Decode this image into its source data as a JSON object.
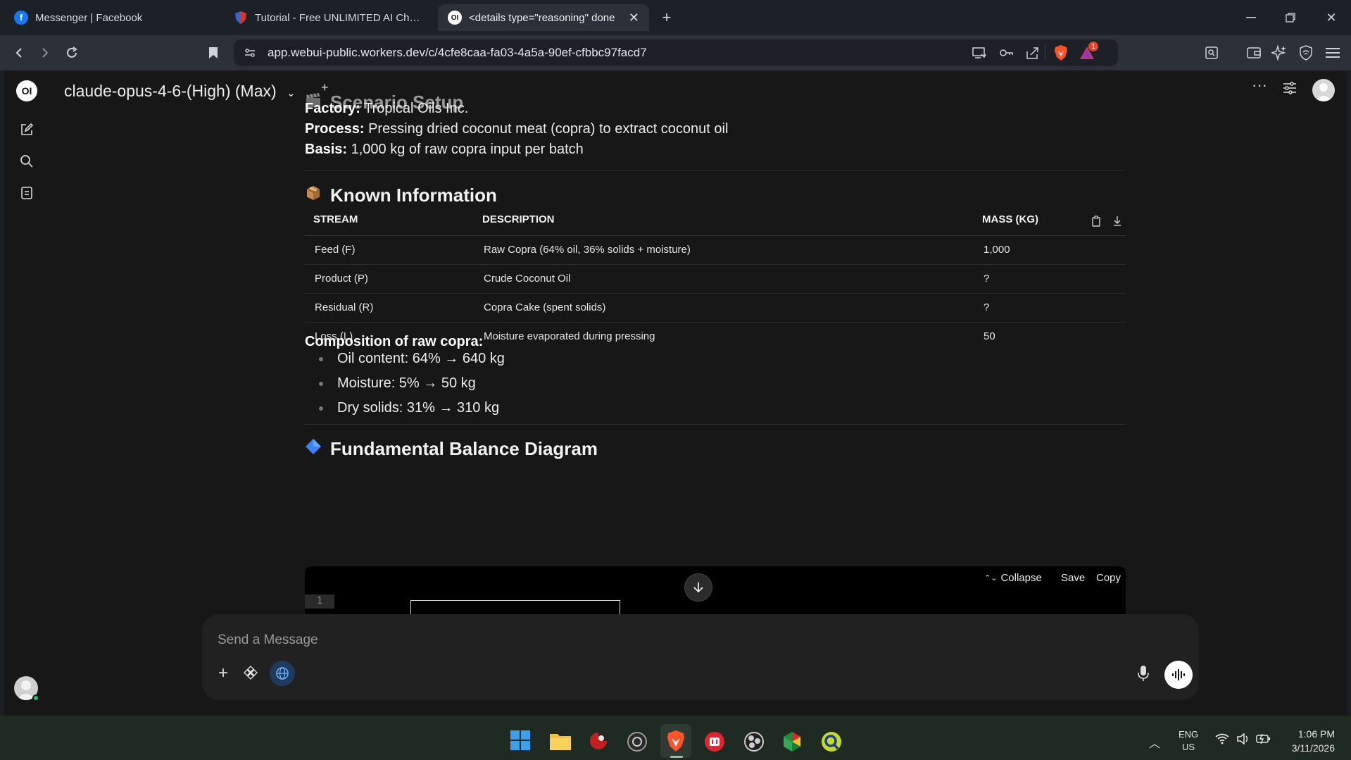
{
  "browser": {
    "tabs": [
      {
        "title": "Messenger | Facebook",
        "icon": "facebook-icon"
      },
      {
        "title": "Tutorial - Free UNLIMITED AI Chat w",
        "icon": "shield-tab-icon"
      },
      {
        "title": "<details type=\"reasoning\" done",
        "icon": "openwebui-icon"
      }
    ],
    "url": "app.webui-public.workers.dev/c/4cfe8caa-fa03-4a5a-90ef-cfbbc97facd7",
    "notification_badge": "1"
  },
  "app": {
    "logo": "OI",
    "model_title": "claude-opus-4-6-(High) (Max)"
  },
  "content": {
    "scenario": {
      "heading": "Scenario Setup",
      "factory_label": "Factory:",
      "factory_value": "Tropical Oils Inc.",
      "process_label": "Process:",
      "process_value": "Pressing dried coconut meat (copra) to extract coconut oil",
      "basis_label": "Basis:",
      "basis_value": "1,000 kg of raw copra input per batch"
    },
    "known": {
      "heading": "Known Information",
      "columns": [
        "STREAM",
        "DESCRIPTION",
        "MASS (KG)"
      ],
      "rows": [
        [
          "Feed (F)",
          "Raw Copra (64% oil, 36% solids + moisture)",
          "1,000"
        ],
        [
          "Product (P)",
          "Crude Coconut Oil",
          "?"
        ],
        [
          "Residual (R)",
          "Copra Cake (spent solids)",
          "?"
        ],
        [
          "Loss (L)",
          "Moisture evaporated during pressing",
          "50"
        ]
      ]
    },
    "composition": {
      "heading": "Composition of raw copra:",
      "items": [
        "Oil content: 64% → 640 kg",
        "Moisture: 5% → 50 kg",
        "Dry solids: 31% → 310 kg"
      ]
    },
    "diagram": {
      "heading": "Fundamental Balance Diagram",
      "collapse": "Collapse",
      "save": "Save",
      "copy": "Copy",
      "line_number": "1"
    }
  },
  "composer": {
    "placeholder": "Send a Message"
  },
  "taskbar": {
    "lang": "ENG",
    "region": "US",
    "time": "1:06 PM",
    "date": "3/11/2026"
  }
}
